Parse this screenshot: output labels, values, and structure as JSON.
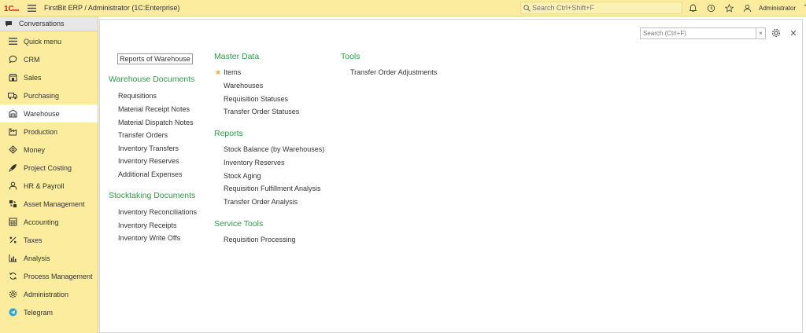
{
  "header": {
    "title": "FirstBit ERP / Administrator  (1C:Enterprise)",
    "search_placeholder": "Search Ctrl+Shift+F",
    "user": "Administrator"
  },
  "sidebar": {
    "conversations_label": "Conversations",
    "items": [
      {
        "label": "Quick menu",
        "icon": "menu-icon"
      },
      {
        "label": "CRM",
        "icon": "chat-icon"
      },
      {
        "label": "Sales",
        "icon": "shop-icon"
      },
      {
        "label": "Purchasing",
        "icon": "truck-icon"
      },
      {
        "label": "Warehouse",
        "icon": "warehouse-icon",
        "active": true
      },
      {
        "label": "Production",
        "icon": "factory-icon"
      },
      {
        "label": "Money",
        "icon": "money-icon"
      },
      {
        "label": "Project Costing",
        "icon": "rocket-icon"
      },
      {
        "label": "HR & Payroll",
        "icon": "person-icon"
      },
      {
        "label": "Asset Management",
        "icon": "asset-icon"
      },
      {
        "label": "Accounting",
        "icon": "calculator-icon"
      },
      {
        "label": "Taxes",
        "icon": "percent-icon"
      },
      {
        "label": "Analysis",
        "icon": "bar-chart-icon"
      },
      {
        "label": "Process Management",
        "icon": "cycle-icon"
      },
      {
        "label": "Administration",
        "icon": "gear-icon"
      },
      {
        "label": "Telegram",
        "icon": "telegram-icon"
      }
    ]
  },
  "panel": {
    "search_placeholder": "Search (Ctrl+F)",
    "clear": "×",
    "close": "✕",
    "col1": {
      "top_link": "Reports of Warehouse",
      "warehouse_documents": {
        "title": "Warehouse Documents",
        "items": [
          "Requisitions",
          "Material Receipt Notes",
          "Material Dispatch Notes",
          "Transfer Orders",
          "Inventory Transfers",
          "Inventory Reserves",
          "Additional Expenses"
        ]
      },
      "stocktaking_documents": {
        "title": "Stocktaking Documents",
        "items": [
          "Inventory Reconciliations",
          "Inventory Receipts",
          "Inventory Write Offs"
        ]
      }
    },
    "col2": {
      "master_data": {
        "title": "Master Data",
        "items": [
          "Items",
          "Warehouses",
          "Requisition Statuses",
          "Transfer Order Statuses"
        ]
      },
      "reports": {
        "title": "Reports",
        "items": [
          "Stock Balance (by Warehouses)",
          "Inventory Reserves",
          "Stock Aging",
          "Requisition Fulfillment Analysis",
          "Transfer Order Analysis"
        ]
      },
      "service_tools": {
        "title": "Service Tools",
        "items": [
          "Requisition Processing"
        ]
      }
    },
    "col3": {
      "tools": {
        "title": "Tools",
        "items": [
          "Transfer Order Adjustments"
        ]
      }
    }
  }
}
